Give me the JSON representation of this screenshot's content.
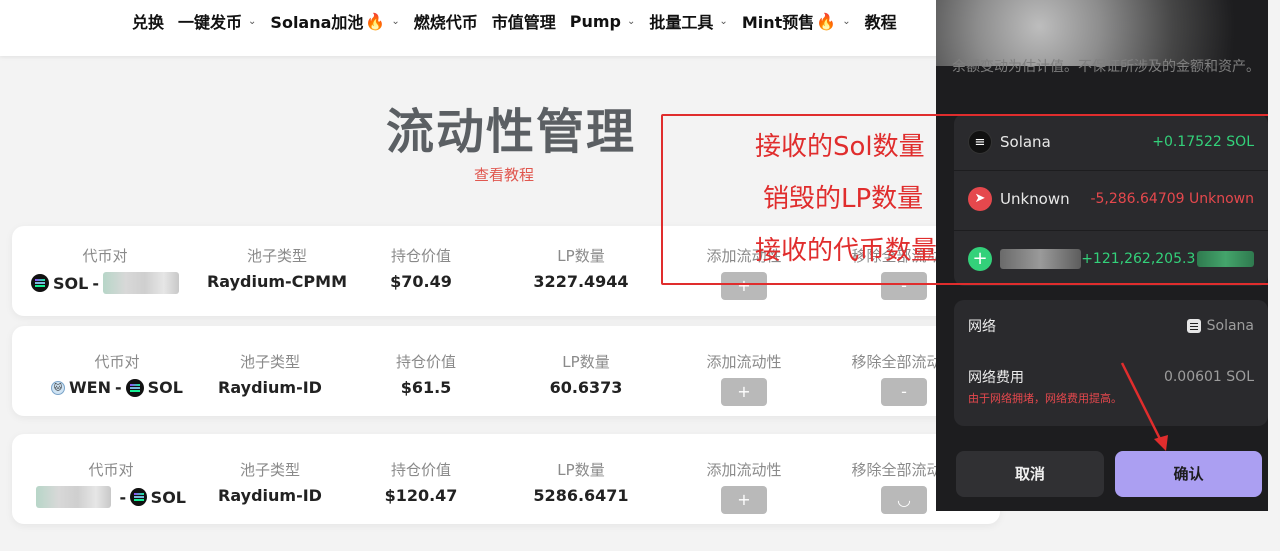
{
  "nav": {
    "items": [
      {
        "label": "兑换",
        "dropdown": false,
        "fire": false
      },
      {
        "label": "一键发币",
        "dropdown": true,
        "fire": false
      },
      {
        "label": "Solana加池",
        "dropdown": true,
        "fire": true
      },
      {
        "label": "燃烧代币",
        "dropdown": false,
        "fire": false
      },
      {
        "label": "市值管理",
        "dropdown": false,
        "fire": false
      },
      {
        "label": "Pump",
        "dropdown": true,
        "fire": false
      },
      {
        "label": "批量工具",
        "dropdown": true,
        "fire": false
      },
      {
        "label": "Mint预售",
        "dropdown": true,
        "fire": true
      },
      {
        "label": "教程",
        "dropdown": false,
        "fire": false
      }
    ]
  },
  "page": {
    "title": "流动性管理",
    "tutorial_link": "查看教程"
  },
  "columns": {
    "pair": "代币对",
    "pool_type": "池子类型",
    "value": "持仓价值",
    "lp": "LP数量",
    "add": "添加流动性",
    "remove": "移除全部流动性"
  },
  "pools": [
    {
      "pair_left": "SOL",
      "pair_right": "",
      "pool_type": "Raydium-CPMM",
      "value": "$70.49",
      "lp": "3227.4944",
      "add_btn": "+",
      "remove_btn": "-"
    },
    {
      "pair_left": "WEN",
      "pair_right": "SOL",
      "pool_type": "Raydium-ID",
      "value": "$61.5",
      "lp": "60.6373",
      "add_btn": "+",
      "remove_btn": "-"
    },
    {
      "pair_left": "",
      "pair_right": "SOL",
      "pool_type": "Raydium-ID",
      "value": "$120.47",
      "lp": "5286.6471",
      "add_btn": "+",
      "remove_btn": "◡"
    }
  ],
  "annotations": {
    "receive_sol": "接收的Sol数量",
    "burn_lp": "销毁的LP数量",
    "receive_token": "接收的代币数量",
    "color": "#e02d2d"
  },
  "wallet": {
    "warning": "余额变动为估计值。不保证所涉及的金额和资产。",
    "changes": [
      {
        "name": "Solana",
        "amount": "+0.17522 SOL",
        "icon": "solana-icon",
        "tone": "green"
      },
      {
        "name": "Unknown",
        "amount": "-5,286.64709 Unknown",
        "icon": "send-icon",
        "tone": "red"
      },
      {
        "name": "",
        "amount": "+121,262,205.3",
        "icon": "plus-icon",
        "tone": "green"
      }
    ],
    "network_label": "网络",
    "network_value": "Solana",
    "fee_label": "网络费用",
    "fee_value": "0.00601 SOL",
    "fee_note": "由于网络拥堵，网络费用提高。",
    "cancel": "取消",
    "confirm": "确认",
    "accent": "#ab9ff2"
  }
}
